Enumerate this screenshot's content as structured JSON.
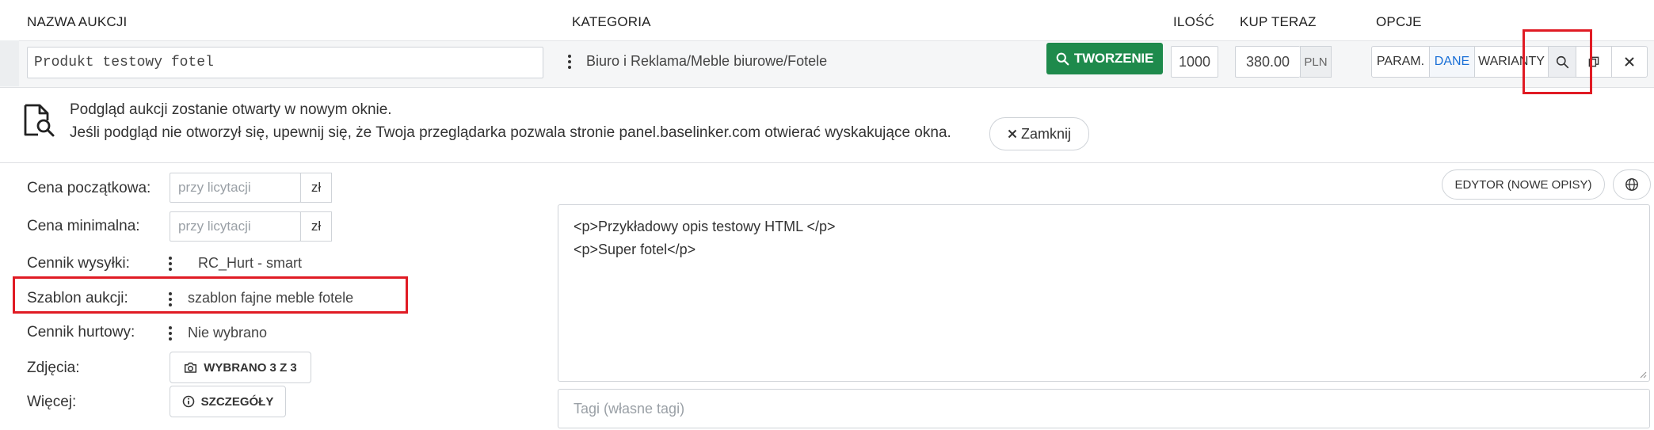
{
  "table_header": {
    "name": "NAZWA AUKCJI",
    "category": "KATEGORIA",
    "quantity": "ILOŚĆ",
    "buy_now": "KUP TERAZ",
    "options": "OPCJE"
  },
  "product_row": {
    "name_value": "Produkt testowy fotel",
    "category_path": "Biuro i Reklama/Meble biurowe/Fotele",
    "create_button": "TWORZENIE",
    "quantity_value": "1000",
    "price_value": "380.00",
    "currency": "PLN",
    "options_tabs": [
      "PARAM.",
      "DANE",
      "WARIANTY"
    ]
  },
  "preview_notice": {
    "line1": "Podgląd aukcji zostanie otwarty w nowym oknie.",
    "line2": "Jeśli podgląd nie otworzył się, upewnij się, że Twoja przeglądarka pozwala stronie panel.baselinker.com otwierać wyskakujące okna.",
    "close_label": "Zamknij"
  },
  "form": {
    "start_price_label": "Cena początkowa:",
    "start_price_placeholder": "przy licytacji",
    "start_price_unit": "zł",
    "min_price_label": "Cena minimalna:",
    "min_price_placeholder": "przy licytacji",
    "min_price_unit": "zł",
    "shipping_label": "Cennik wysyłki:",
    "shipping_value": "RC_Hurt - smart",
    "template_label": "Szablon aukcji:",
    "template_value": "szablon fajne meble fotele",
    "wholesale_label": "Cennik hurtowy:",
    "wholesale_value": "Nie wybrano",
    "photos_label": "Zdjęcia:",
    "photos_button": "WYBRANO 3 Z 3",
    "more_label": "Więcej:",
    "more_button": "SZCZEGÓŁY"
  },
  "editor": {
    "editor_button": "EDYTOR (NOWE OPISY)",
    "description_line1": "<p>Przykładowy opis testowy HTML </p>",
    "description_line2": "<p>Super fotel</p>",
    "tags_placeholder": "Tagi (własne tagi)"
  },
  "colors": {
    "green": "#1e8a4c",
    "highlight_red": "#e01b24",
    "active_tab_blue": "#1a6fd6"
  }
}
